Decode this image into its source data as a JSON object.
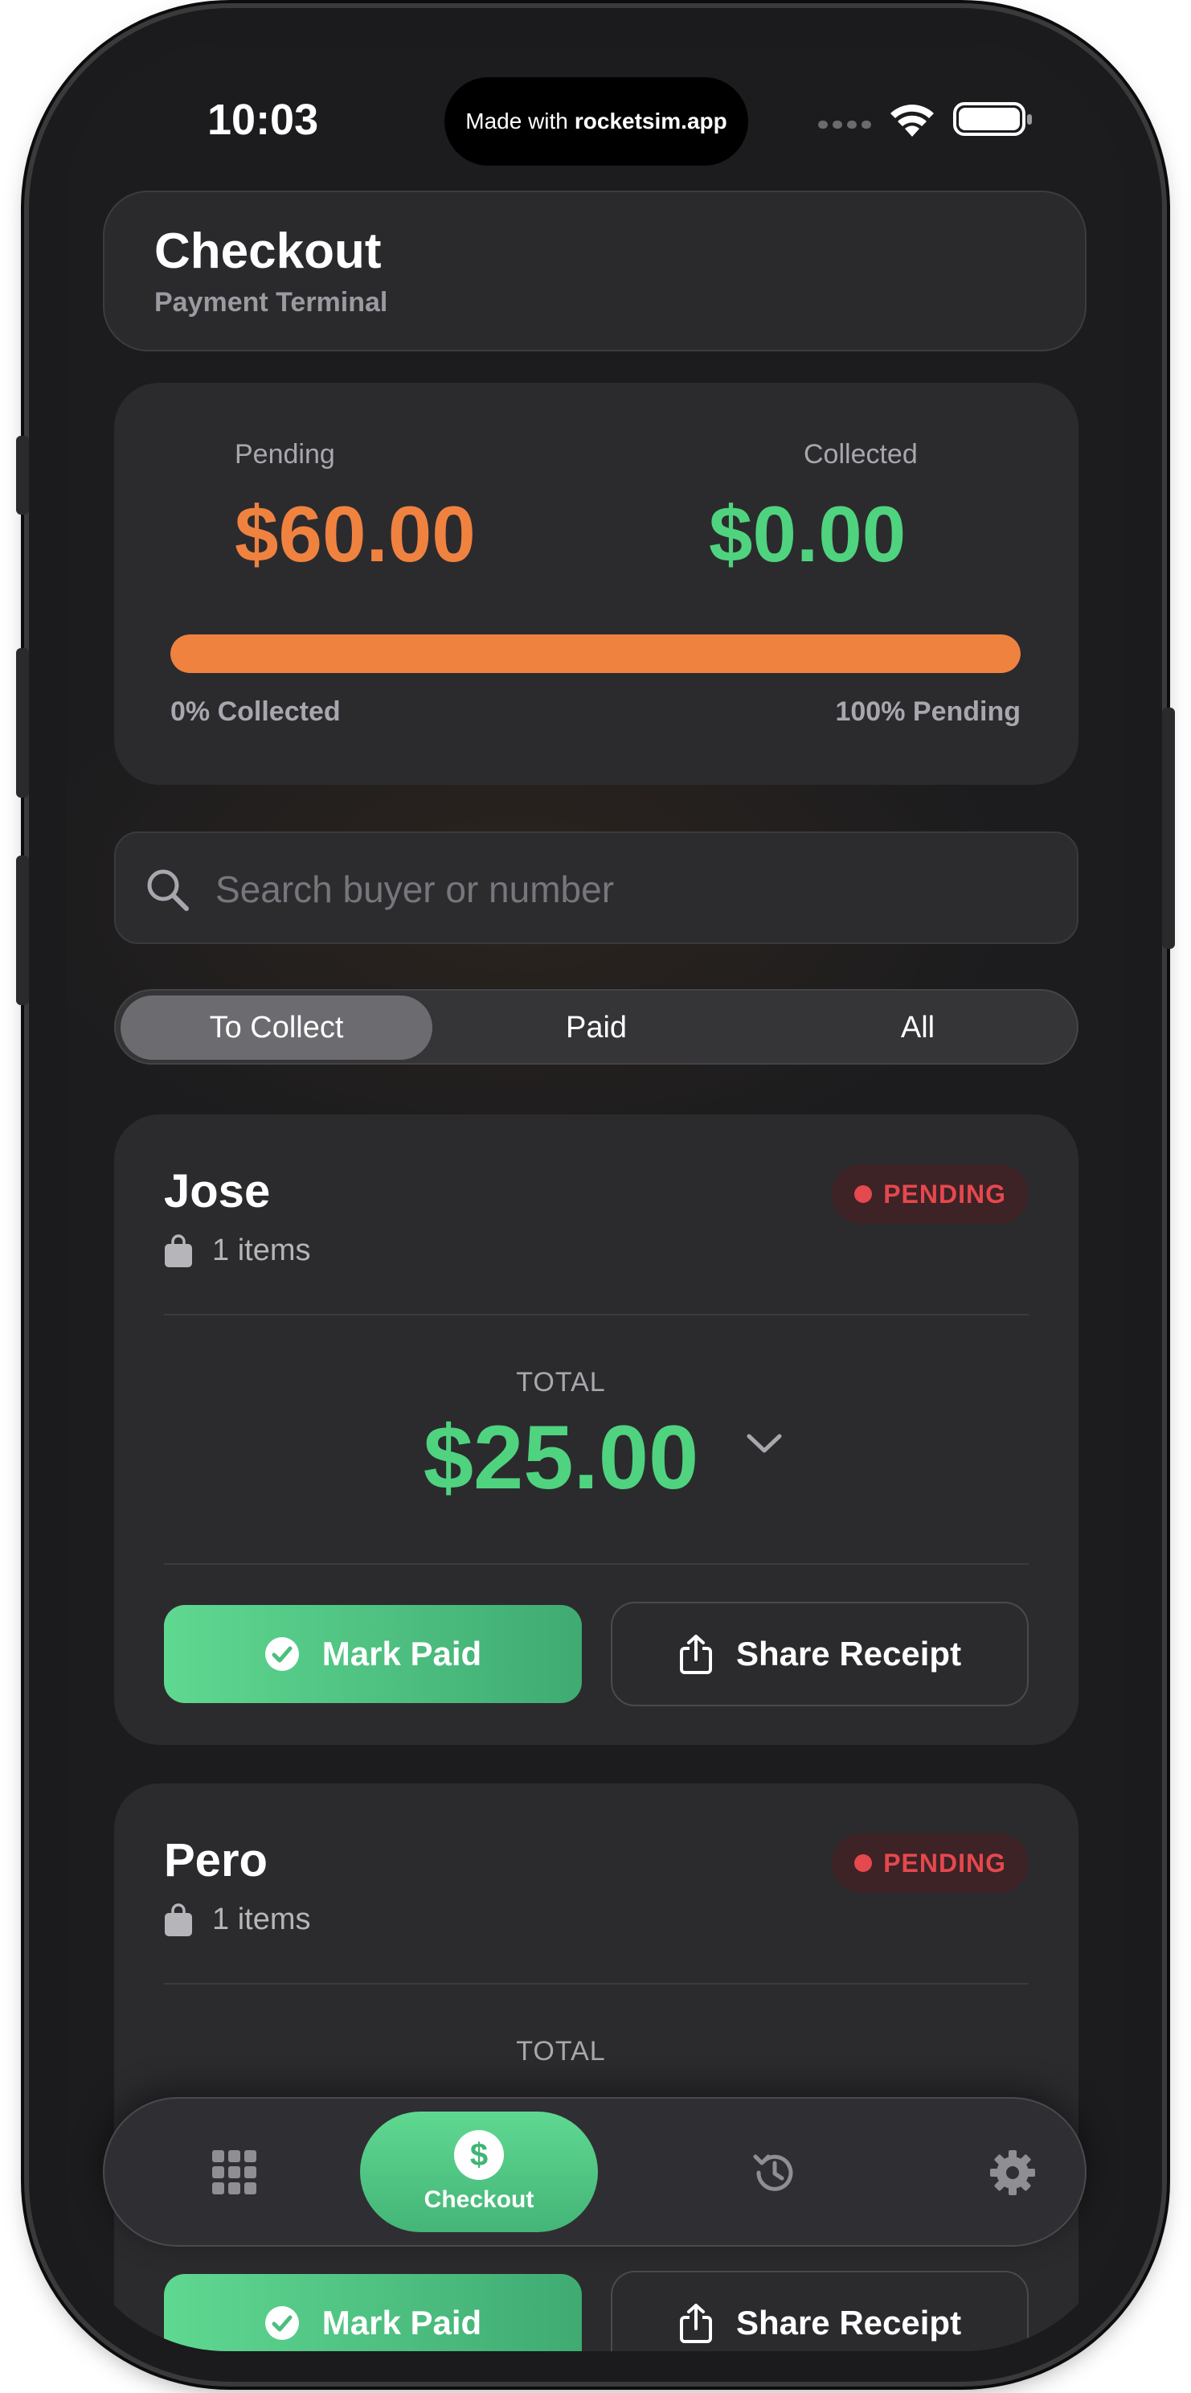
{
  "status_bar": {
    "time": "10:03",
    "island_prefix": "Made with",
    "island_brand": "rocketsim.app",
    "icons": [
      "cellular-dots-icon",
      "wifi-icon",
      "battery-icon"
    ]
  },
  "header": {
    "title": "Checkout",
    "subtitle": "Payment Terminal"
  },
  "summary": {
    "pending_label": "Pending",
    "pending_value": "$60.00",
    "collected_label": "Collected",
    "collected_value": "$0.00",
    "collected_fraction": 0.0,
    "pending_fraction": 1.0,
    "collected_text": "0% Collected",
    "pending_text": "100% Pending"
  },
  "search": {
    "placeholder": "Search buyer or number",
    "value": "",
    "icon": "search-icon"
  },
  "segments": [
    {
      "label": "To Collect",
      "active": true
    },
    {
      "label": "Paid",
      "active": false
    },
    {
      "label": "All",
      "active": false
    }
  ],
  "orders": [
    {
      "buyer": "Jose",
      "status": "PENDING",
      "items": "1 items",
      "total_label": "TOTAL",
      "total": "$25.00",
      "mark_paid": "Mark Paid",
      "share": "Share Receipt"
    },
    {
      "buyer": "Pero",
      "status": "PENDING",
      "items": "1 items",
      "total_label": "TOTAL",
      "total": "",
      "mark_paid": "Mark Paid",
      "share": "Share Receipt"
    }
  ],
  "tabbar": {
    "items": [
      {
        "icon": "grid-icon",
        "label": ""
      },
      {
        "icon": "dollar-icon",
        "label": "Checkout",
        "active": true
      },
      {
        "icon": "history-icon",
        "label": ""
      },
      {
        "icon": "gear-icon",
        "label": ""
      }
    ]
  },
  "colors": {
    "pending": "#F08240",
    "collected": "#4FD37F",
    "badge": "#E5484D",
    "background": "#1C1C1E"
  }
}
